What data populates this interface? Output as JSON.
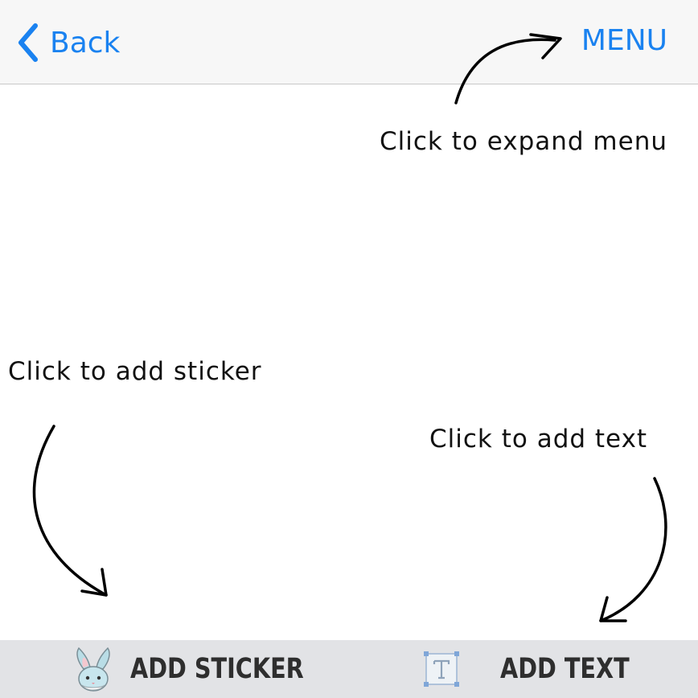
{
  "nav": {
    "back_label": "Back",
    "menu_label": "MENU",
    "accent_color": "#1a82f0",
    "back_icon": "chevron-left-icon"
  },
  "hints": {
    "menu": "Click to expand menu",
    "sticker": "Click to add sticker",
    "text": "Click to add text"
  },
  "toolbar": {
    "sticker_label": "ADD STICKER",
    "sticker_icon": "bunny-icon",
    "text_label": "ADD TEXT",
    "text_icon": "text-box-icon"
  }
}
